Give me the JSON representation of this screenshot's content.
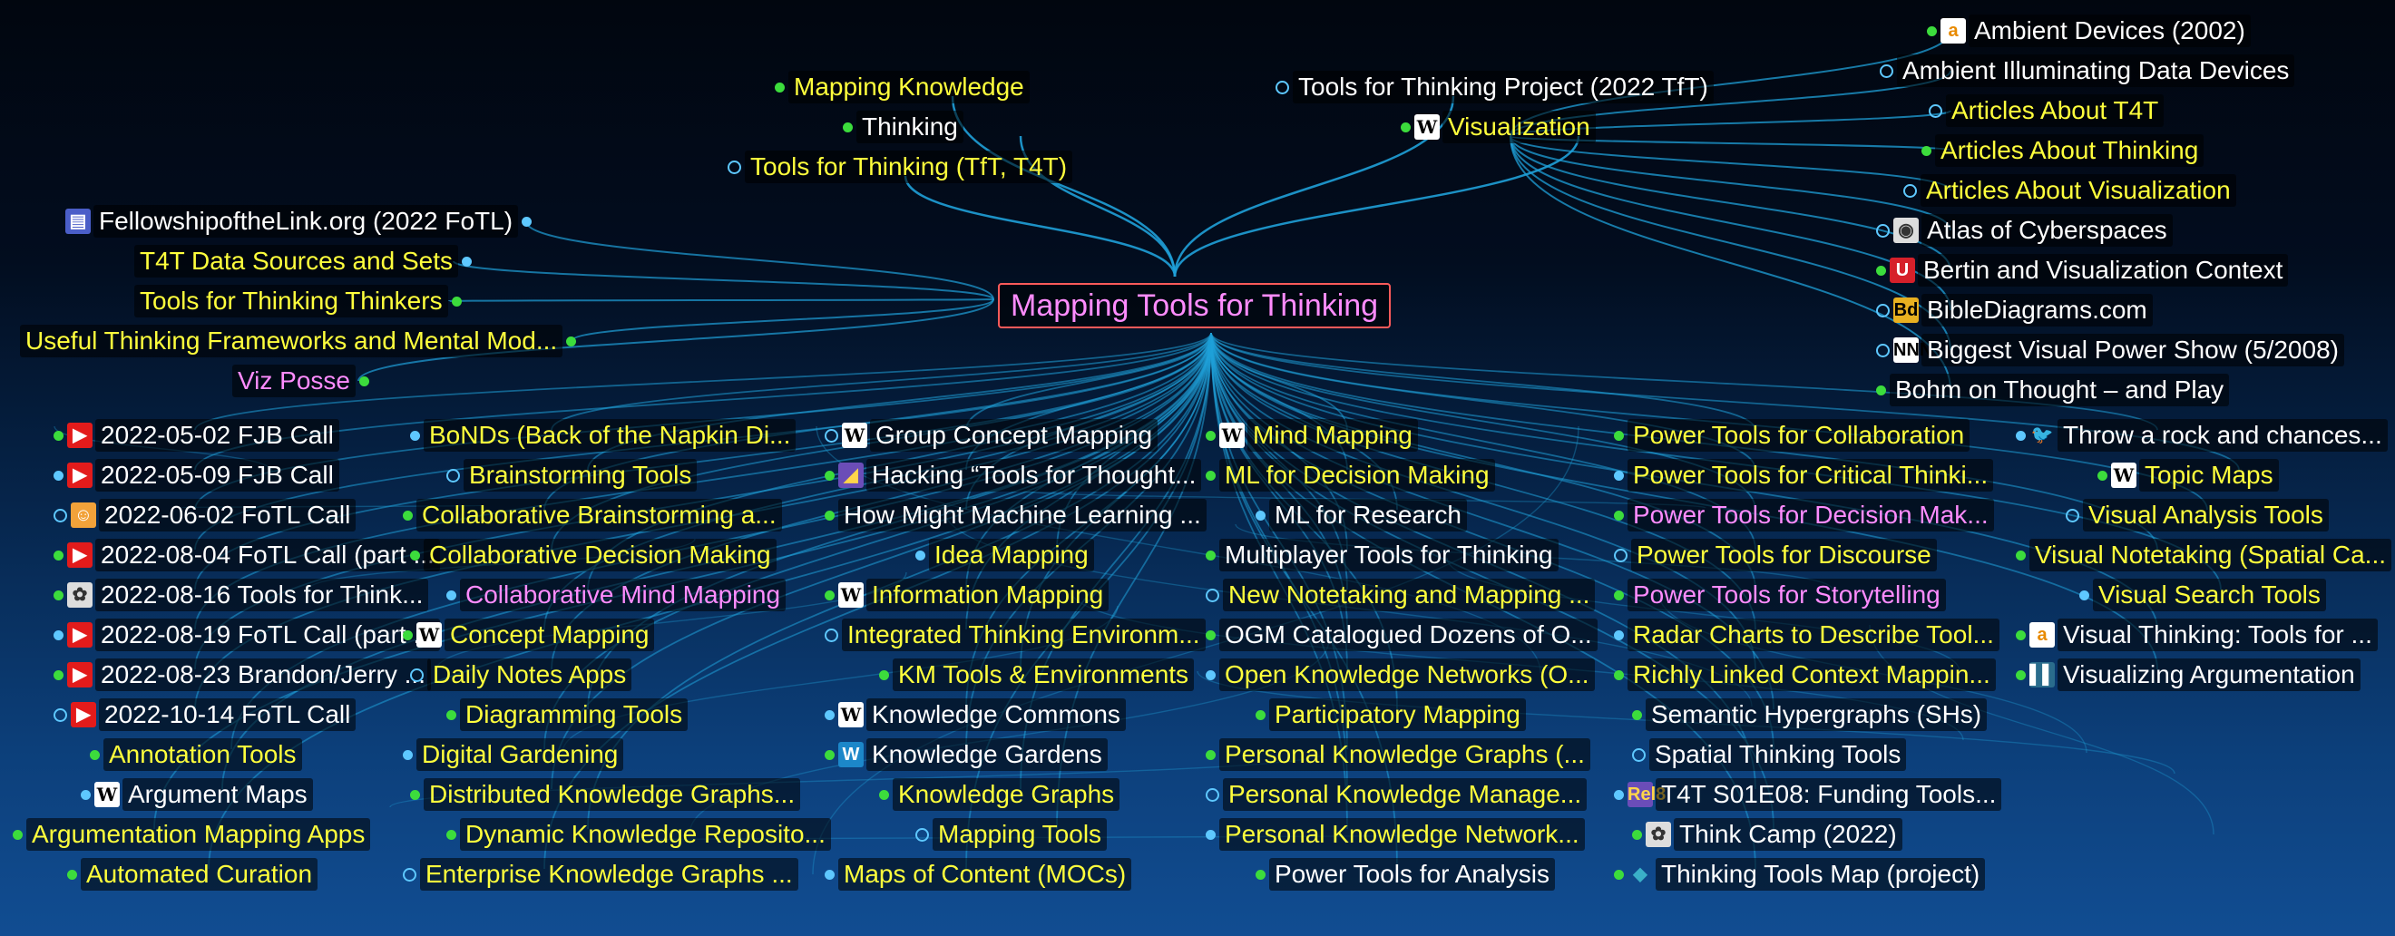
{
  "colors": {
    "link": "#1fa0d8",
    "yellow": "#ffff3c",
    "white": "#ffffff",
    "pink": "#ff8cff",
    "dot_green": "#3cdc3c",
    "dot_blue": "#5ec8ff",
    "center_border": "#ff5a5a"
  },
  "center": {
    "label": "Mapping Tools for Thinking"
  },
  "parents": [
    {
      "label": "Mapping Knowledge",
      "color": "yellow",
      "dot": "green"
    },
    {
      "label": "Thinking",
      "color": "white",
      "dot": "green"
    },
    {
      "label": "Tools for Thinking (TfT, T4T)",
      "color": "yellow",
      "dot": "hollow"
    },
    {
      "label": "Tools for Thinking Project (2022 TfT)",
      "color": "white",
      "dot": "hollow"
    },
    {
      "label": "Visualization",
      "color": "yellow",
      "dot": "green",
      "icon": "wikipedia-icon"
    }
  ],
  "left_parents": [
    {
      "label": "FellowshipoftheLink.org (2022 FoTL)",
      "color": "white",
      "icon": "folder-icon"
    },
    {
      "label": "T4T Data Sources and Sets",
      "color": "yellow"
    },
    {
      "label": "Tools for Thinking Thinkers",
      "color": "yellow"
    },
    {
      "label": "Useful Thinking Frameworks and Mental Mod...",
      "color": "yellow"
    },
    {
      "label": "Viz Posse",
      "color": "pink"
    }
  ],
  "right_top": [
    {
      "label": "Ambient Devices (2002)",
      "color": "white",
      "icon": "amazon-icon"
    },
    {
      "label": "Ambient Illuminating Data Devices",
      "color": "white"
    },
    {
      "label": "Articles About T4T",
      "color": "yellow"
    },
    {
      "label": "Articles About Thinking",
      "color": "yellow"
    },
    {
      "label": "Articles About Visualization",
      "color": "yellow"
    },
    {
      "label": "Atlas of Cyberspaces",
      "color": "white",
      "icon": "globe-icon"
    },
    {
      "label": "Bertin and Visualization Context",
      "color": "white",
      "icon": "u-logo-icon"
    },
    {
      "label": "BibleDiagrams.com",
      "color": "white",
      "icon": "bd-logo-icon"
    },
    {
      "label": "Biggest Visual Power Show (5/2008)",
      "color": "white",
      "icon": "nnn-logo-icon"
    },
    {
      "label": "Bohm on Thought – and Play",
      "color": "white"
    }
  ],
  "columns": [
    [
      {
        "label": "2022-05-02 FJB Call",
        "color": "white",
        "icon": "youtube-icon"
      },
      {
        "label": "2022-05-09 FJB Call",
        "color": "white",
        "icon": "youtube-icon"
      },
      {
        "label": "2022-06-02 FoTL Call",
        "color": "white",
        "icon": "lion-icon"
      },
      {
        "label": "2022-08-04 FoTL Call (part ...",
        "color": "white",
        "icon": "youtube-icon"
      },
      {
        "label": "2022-08-16 Tools for Think...",
        "color": "white",
        "icon": "brain-icon"
      },
      {
        "label": "2022-08-19 FoTL Call (part ...",
        "color": "white",
        "icon": "youtube-icon"
      },
      {
        "label": "2022-08-23 Brandon/Jerry ...",
        "color": "white",
        "icon": "youtube-icon"
      },
      {
        "label": "2022-10-14 FoTL Call",
        "color": "white",
        "icon": "youtube-icon"
      },
      {
        "label": "Annotation Tools",
        "color": "yellow"
      },
      {
        "label": "Argument Maps",
        "color": "white",
        "icon": "wikipedia-icon"
      },
      {
        "label": "Argumentation Mapping Apps",
        "color": "yellow"
      },
      {
        "label": "Automated Curation",
        "color": "yellow"
      }
    ],
    [
      {
        "label": "BoNDs (Back of the Napkin Di...",
        "color": "yellow"
      },
      {
        "label": "Brainstorming Tools",
        "color": "yellow"
      },
      {
        "label": "Collaborative Brainstorming a...",
        "color": "yellow"
      },
      {
        "label": "Collaborative Decision Making",
        "color": "yellow"
      },
      {
        "label": "Collaborative Mind Mapping",
        "color": "pink"
      },
      {
        "label": "Concept Mapping",
        "color": "yellow",
        "icon": "wikipedia-icon"
      },
      {
        "label": "Daily Notes Apps",
        "color": "yellow"
      },
      {
        "label": "Diagramming Tools",
        "color": "yellow"
      },
      {
        "label": "Digital Gardening",
        "color": "yellow"
      },
      {
        "label": "Distributed Knowledge Graphs...",
        "color": "yellow"
      },
      {
        "label": "Dynamic Knowledge Reposito...",
        "color": "yellow"
      },
      {
        "label": "Enterprise Knowledge Graphs ...",
        "color": "yellow"
      }
    ],
    [
      {
        "label": "Group Concept Mapping",
        "color": "white",
        "icon": "wikipedia-icon"
      },
      {
        "label": "Hacking “Tools for Thought...",
        "color": "white",
        "icon": "hack-logo-icon"
      },
      {
        "label": "How Might Machine Learning ...",
        "color": "white"
      },
      {
        "label": "Idea Mapping",
        "color": "yellow"
      },
      {
        "label": "Information Mapping",
        "color": "yellow",
        "icon": "wikipedia-icon"
      },
      {
        "label": "Integrated Thinking Environm...",
        "color": "yellow"
      },
      {
        "label": "KM Tools & Environments",
        "color": "yellow"
      },
      {
        "label": "Knowledge Commons",
        "color": "white",
        "icon": "wikipedia-icon"
      },
      {
        "label": "Knowledge Gardens",
        "color": "white",
        "icon": "wordpress-icon"
      },
      {
        "label": "Knowledge Graphs",
        "color": "yellow"
      },
      {
        "label": "Mapping Tools",
        "color": "yellow"
      },
      {
        "label": "Maps of Content (MOCs)",
        "color": "yellow"
      }
    ],
    [
      {
        "label": "Mind Mapping",
        "color": "yellow",
        "icon": "wikipedia-icon"
      },
      {
        "label": "ML for Decision Making",
        "color": "yellow"
      },
      {
        "label": "ML for Research",
        "color": "white"
      },
      {
        "label": "Multiplayer Tools for Thinking",
        "color": "white"
      },
      {
        "label": "New Notetaking and Mapping ...",
        "color": "yellow"
      },
      {
        "label": "OGM Catalogued Dozens of O...",
        "color": "white"
      },
      {
        "label": "Open Knowledge Networks (O...",
        "color": "yellow"
      },
      {
        "label": "Participatory Mapping",
        "color": "yellow"
      },
      {
        "label": "Personal Knowledge Graphs (...",
        "color": "yellow"
      },
      {
        "label": "Personal Knowledge Manage...",
        "color": "yellow"
      },
      {
        "label": "Personal Knowledge Network...",
        "color": "yellow"
      },
      {
        "label": "Power Tools for Analysis",
        "color": "white"
      }
    ],
    [
      {
        "label": "Power Tools for Collaboration",
        "color": "yellow"
      },
      {
        "label": "Power Tools for Critical Thinki...",
        "color": "yellow"
      },
      {
        "label": "Power Tools for Decision Mak...",
        "color": "pink"
      },
      {
        "label": "Power Tools for Discourse",
        "color": "yellow"
      },
      {
        "label": "Power Tools for Storytelling",
        "color": "pink"
      },
      {
        "label": "Radar Charts to Describe Tool...",
        "color": "yellow"
      },
      {
        "label": "Richly Linked Context Mappin...",
        "color": "yellow"
      },
      {
        "label": "Semantic Hypergraphs (SHs)",
        "color": "white"
      },
      {
        "label": "Spatial Thinking Tools",
        "color": "white"
      },
      {
        "label": "T4T S01E08: Funding Tools...",
        "color": "white",
        "icon": "rel8-logo-icon"
      },
      {
        "label": "Think Camp (2022)",
        "color": "white",
        "icon": "brain-icon"
      },
      {
        "label": "Thinking Tools Map (project)",
        "color": "white",
        "icon": "diamond-icon"
      }
    ],
    [
      {
        "label": "Throw a rock  and chances...",
        "color": "white",
        "icon": "twitter-icon"
      },
      {
        "label": "Topic Maps",
        "color": "yellow",
        "icon": "wikipedia-icon"
      },
      {
        "label": "Visual Analysis Tools",
        "color": "yellow"
      },
      {
        "label": "Visual Notetaking (Spatial Ca...",
        "color": "yellow"
      },
      {
        "label": "Visual Search Tools",
        "color": "yellow"
      },
      {
        "label": "Visual Thinking: Tools for ...",
        "color": "white",
        "icon": "amazon-icon"
      },
      {
        "label": "Visualizing Argumentation",
        "color": "white",
        "icon": "argument-logo-icon"
      }
    ]
  ]
}
